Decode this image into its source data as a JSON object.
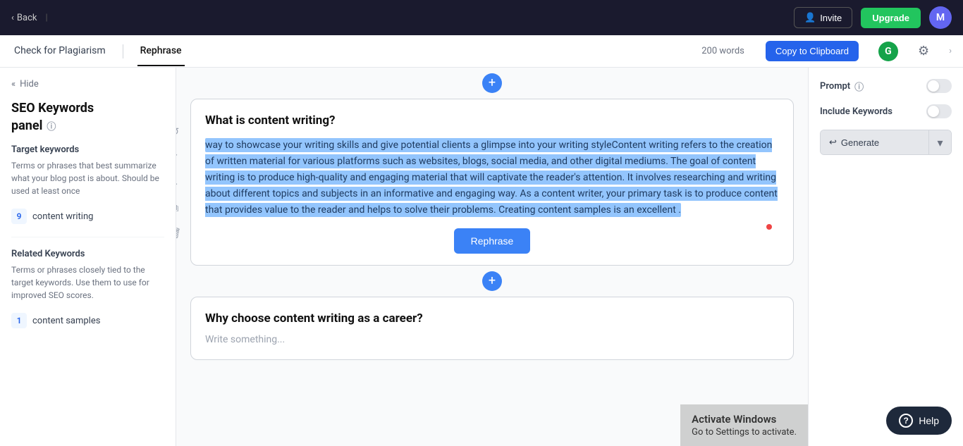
{
  "topNav": {
    "back_label": "Back",
    "divider": "|",
    "invite_label": "Invite",
    "upgrade_label": "Upgrade",
    "avatar_letter": "M"
  },
  "secondaryNav": {
    "plagiarism_label": "Check for Plagiarism",
    "rephrase_label": "Rephrase",
    "word_count": "200 words",
    "copy_label": "Copy to Clipboard",
    "grammarly_letter": "G"
  },
  "sidebar": {
    "hide_label": "Hide",
    "panel_title": "SEO Keywords",
    "panel_subtitle": "panel",
    "target_title": "Target keywords",
    "target_desc": "Terms or phrases that best summarize what your blog post is about. Should be used at least once",
    "keywords": [
      {
        "count": "9",
        "text": "content writing"
      }
    ],
    "related_title": "Related Keywords",
    "related_desc": "Terms or phrases closely tied to the target keywords. Use them to use for improved SEO scores.",
    "related_keywords": [
      {
        "count": "1",
        "text": "content samples"
      }
    ]
  },
  "editor": {
    "block1": {
      "heading": "What is content writing?",
      "selected_text": "way to showcase your writing skills and give potential clients a glimpse into your writing styleContent writing refers to the creation of written material for various platforms such as websites, blogs, social media, and other digital mediums. The goal of content writing is to produce high-quality and engaging material that will captivate the reader's attention. It involves researching and writing about different topics and subjects in an informative and engaging way. As a content writer, your primary task is to produce content that provides value to the reader and helps to solve their problems. Creating content samples is an excellent .",
      "rephrase_label": "Rephrase"
    },
    "block2": {
      "heading": "Why choose content writing as a career?",
      "placeholder": "Write something..."
    }
  },
  "rightPanel": {
    "prompt_label": "Prompt",
    "include_keywords_label": "Include Keywords",
    "generate_label": "Generate"
  },
  "activateWindows": {
    "title": "Activate Windows",
    "subtitle": "Go to Settings to activate."
  },
  "help": {
    "label": "Help"
  }
}
